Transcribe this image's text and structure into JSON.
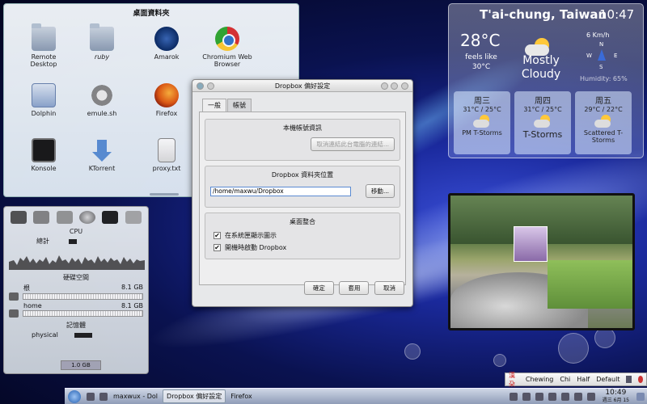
{
  "folder_view": {
    "title": "桌面資料夾",
    "items": [
      {
        "label": "Remote Desktop",
        "icon": "folder-icon"
      },
      {
        "label": "ruby",
        "icon": "folder-icon"
      },
      {
        "label": "Amarok",
        "icon": "amarok-icon"
      },
      {
        "label": "Chromium Web Browser",
        "icon": "chromium-icon"
      },
      {
        "label": "Dolphin",
        "icon": "dolphin-icon"
      },
      {
        "label": "emule.sh",
        "icon": "script-icon"
      },
      {
        "label": "Firefox",
        "icon": "firefox-icon"
      },
      {
        "label": "Konsole",
        "icon": "konsole-icon"
      },
      {
        "label": "KTorrent",
        "icon": "ktorrent-icon"
      },
      {
        "label": "proxy.txt",
        "icon": "text-file-icon"
      }
    ]
  },
  "system_monitor": {
    "cpu_label": "CPU",
    "total_label": "總計",
    "disk_section": "硬碟空間",
    "disks": [
      {
        "name": "根",
        "size": "8.1 GB"
      },
      {
        "name": "home",
        "size": "8.1 GB"
      }
    ],
    "memory_section": "記憶體",
    "memory_label": "physical",
    "memory_total": "1.0 GB"
  },
  "weather": {
    "location": "T'ai-chung, Taiwan",
    "time": "10:47",
    "temperature": "28°C",
    "feels_like": "feels like 30°C",
    "condition": "Mostly Cloudy",
    "wind": "6 Km/h",
    "compass": {
      "n": "N",
      "e": "E",
      "w": "W",
      "s": "S"
    },
    "humidity": "Humidity: 65%",
    "forecast": [
      {
        "day": "周三",
        "temps": "31°C / 25°C",
        "condition": "PM T-Storms"
      },
      {
        "day": "周四",
        "temps": "31°C / 25°C",
        "condition": "T-Storms"
      },
      {
        "day": "周五",
        "temps": "29°C / 22°C",
        "condition": "Scattered T-Storms"
      }
    ]
  },
  "dialog": {
    "title": "Dropbox 偏好設定",
    "tabs": [
      "一般",
      "帳號"
    ],
    "account_group": "本機帳號資訊",
    "unlink_button": "取消連結此台電腦的連結...",
    "folder_group": "Dropbox 資料夾位置",
    "folder_path": "/home/maxwu/Dropbox",
    "move_button": "移動...",
    "desktop_group": "桌面整合",
    "check_tray": "在系統匣顯示圖示",
    "check_startup": "開機時啟動 Dropbox",
    "ok_button": "確定",
    "apply_button": "套用",
    "cancel_button": "取消"
  },
  "im_bar": {
    "mode": "漢 朶",
    "engine": "Chewing",
    "chi": "Chi",
    "half": "Half",
    "default": "Default"
  },
  "taskbar": {
    "tasks": [
      "maxwux - Dol",
      "Dropbox 偏好設定",
      "Firefox"
    ],
    "clock_time": "10:49",
    "clock_date": "週三 6月 15"
  }
}
